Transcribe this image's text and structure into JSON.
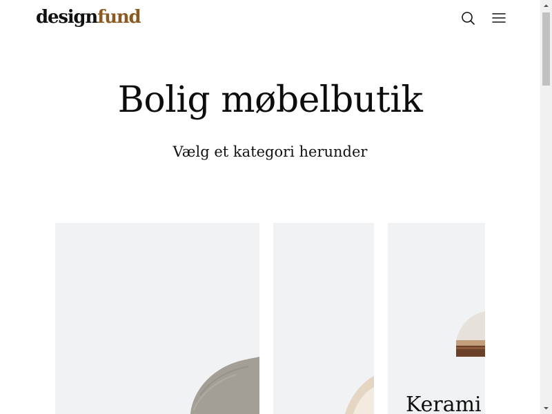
{
  "header": {
    "logo": {
      "part1": "design",
      "part2": "fund"
    },
    "search_icon": "search-icon",
    "menu_icon": "hamburger-menu-icon"
  },
  "hero": {
    "title": "Bolig møbelbutik",
    "subtitle": "Vælg et kategori herunder"
  },
  "categories": [
    {
      "label": "",
      "image": "upholstered-chair-image"
    },
    {
      "label": "",
      "image": "pendant-lamp-image"
    },
    {
      "label": "Kerami",
      "image": "ceramic-lamp-image"
    }
  ],
  "colors": {
    "logo_accent": "#8a5a22",
    "card_background": "#f1f2f4",
    "text": "#111111"
  }
}
